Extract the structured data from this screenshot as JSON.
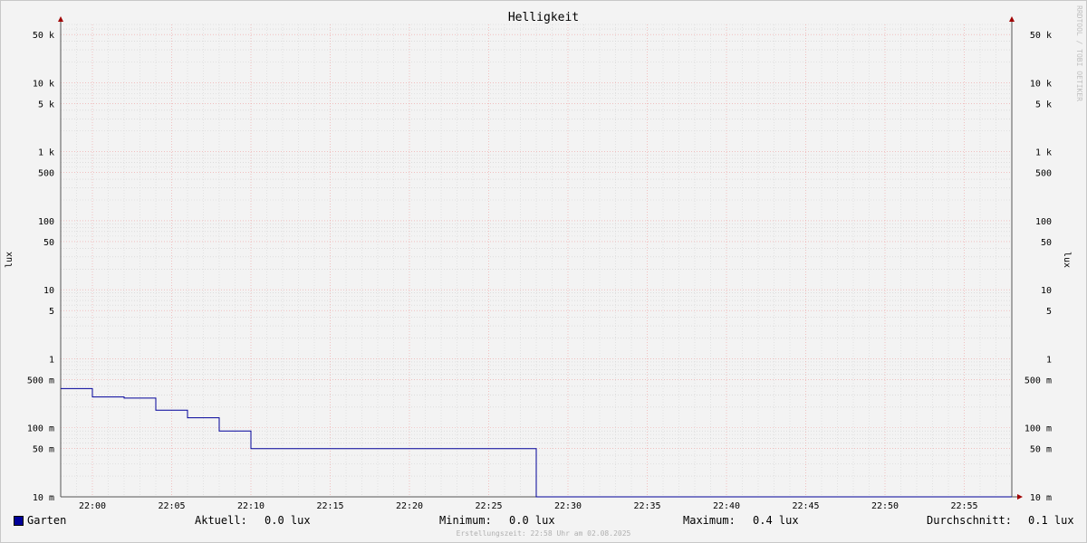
{
  "chart_data": {
    "type": "line",
    "title": "Helligkeit",
    "ylabel": "lux",
    "yscale": "log",
    "ylim": [
      10,
      70000
    ],
    "x_ticks": [
      "22:00",
      "22:05",
      "22:10",
      "22:15",
      "22:20",
      "22:25",
      "22:30",
      "22:35",
      "22:40",
      "22:45",
      "22:50",
      "22:55"
    ],
    "y_tick_labels": [
      {
        "value": 50000,
        "label": "50 k"
      },
      {
        "value": 10000,
        "label": "10 k"
      },
      {
        "value": 5000,
        "label": "5 k"
      },
      {
        "value": 1000,
        "label": "1 k"
      },
      {
        "value": 500,
        "label": "500"
      },
      {
        "value": 100,
        "label": "100"
      },
      {
        "value": 50,
        "label": "50"
      },
      {
        "value": 10,
        "label": "10"
      },
      {
        "value": 5,
        "label": "5"
      },
      {
        "value": 1,
        "label": "1"
      },
      {
        "value": 0.5,
        "label": "500 m"
      },
      {
        "value": 0.1,
        "label": "100 m"
      },
      {
        "value": 0.05,
        "label": "50 m"
      },
      {
        "value": 0.01,
        "label": "10 m"
      }
    ],
    "series": [
      {
        "name": "Garten",
        "color": "#000099",
        "points": [
          {
            "x": "21:58",
            "y": 0.37
          },
          {
            "x": "22:00",
            "y": 0.28
          },
          {
            "x": "22:02",
            "y": 0.27
          },
          {
            "x": "22:04",
            "y": 0.18
          },
          {
            "x": "22:06",
            "y": 0.14
          },
          {
            "x": "22:08",
            "y": 0.09
          },
          {
            "x": "22:10",
            "y": 0.05
          },
          {
            "x": "22:12",
            "y": 0.05
          },
          {
            "x": "22:28",
            "y": 0.01
          },
          {
            "x": "22:58",
            "y": 0.01
          }
        ]
      }
    ],
    "grid": true
  },
  "legend": {
    "series_name": "Garten",
    "stats": [
      {
        "label": "Aktuell:",
        "value": "0.0 lux"
      },
      {
        "label": "Minimum:",
        "value": "0.0 lux"
      },
      {
        "label": "Maximum:",
        "value": "0.4 lux"
      },
      {
        "label": "Durchschnitt:",
        "value": "0.1 lux"
      }
    ]
  },
  "footer": "Erstellungszeit: 22:58 Uhr am 02.08.2025",
  "watermark": "RRDTOOL / TOBI OETIKER"
}
